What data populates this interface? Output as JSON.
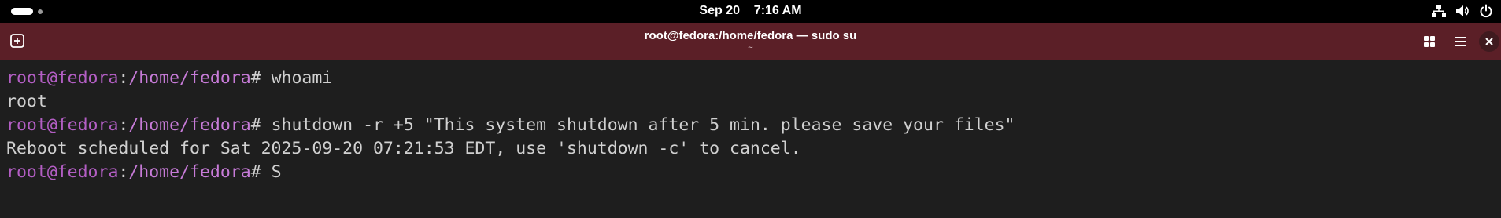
{
  "topbar": {
    "date": "Sep 20",
    "time": "7:16 AM",
    "icons": [
      "activities-pill",
      "workspace-dot",
      "network-icon",
      "volume-icon",
      "power-icon"
    ]
  },
  "window": {
    "title": "root@fedora:/home/fedora — sudo su",
    "subtitle": "~",
    "buttons": [
      "new-tab-icon",
      "tab-overview-icon",
      "menu-icon",
      "close-icon"
    ],
    "accent_color": "#5b1f27"
  },
  "terminal": {
    "lines": [
      {
        "user": "root@fedora",
        "sep": ":",
        "path": "/home/fedora",
        "prompt": "# ",
        "command": "whoami"
      },
      {
        "output": "root"
      },
      {
        "user": "root@fedora",
        "sep": ":",
        "path": "/home/fedora",
        "prompt": "# ",
        "command": "shutdown -r +5 \"This system shutdown after 5 min. please save your files\""
      },
      {
        "output": "Reboot scheduled for Sat 2025-09-20 07:21:53 EDT, use 'shutdown -c' to cancel."
      },
      {
        "user": "root@fedora",
        "sep": ":",
        "path": "/home/fedora",
        "prompt": "# ",
        "command": "S"
      }
    ],
    "colors": {
      "user": "#b35ec4",
      "path": "#c77bd8",
      "text": "#d0d0d0",
      "background": "#1e1e1e"
    }
  }
}
